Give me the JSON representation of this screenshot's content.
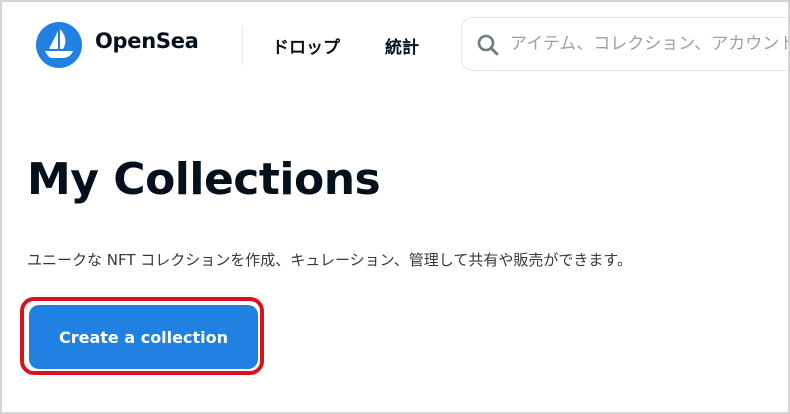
{
  "header": {
    "brand": "OpenSea",
    "logo_icon": "opensea-boat-logo",
    "nav": [
      {
        "label": "ドロップ"
      },
      {
        "label": "統計"
      }
    ],
    "search": {
      "icon": "search-icon",
      "placeholder": "アイテム、コレクション、アカウントを検索"
    }
  },
  "main": {
    "title": "My Collections",
    "description": "ユニークな NFT コレクションを作成、キュレーション、管理して共有や販売ができます。",
    "create_button_label": "Create a collection"
  },
  "colors": {
    "accent": "#2081e2",
    "highlight_border": "#d8121f",
    "text_primary": "#04111d"
  }
}
